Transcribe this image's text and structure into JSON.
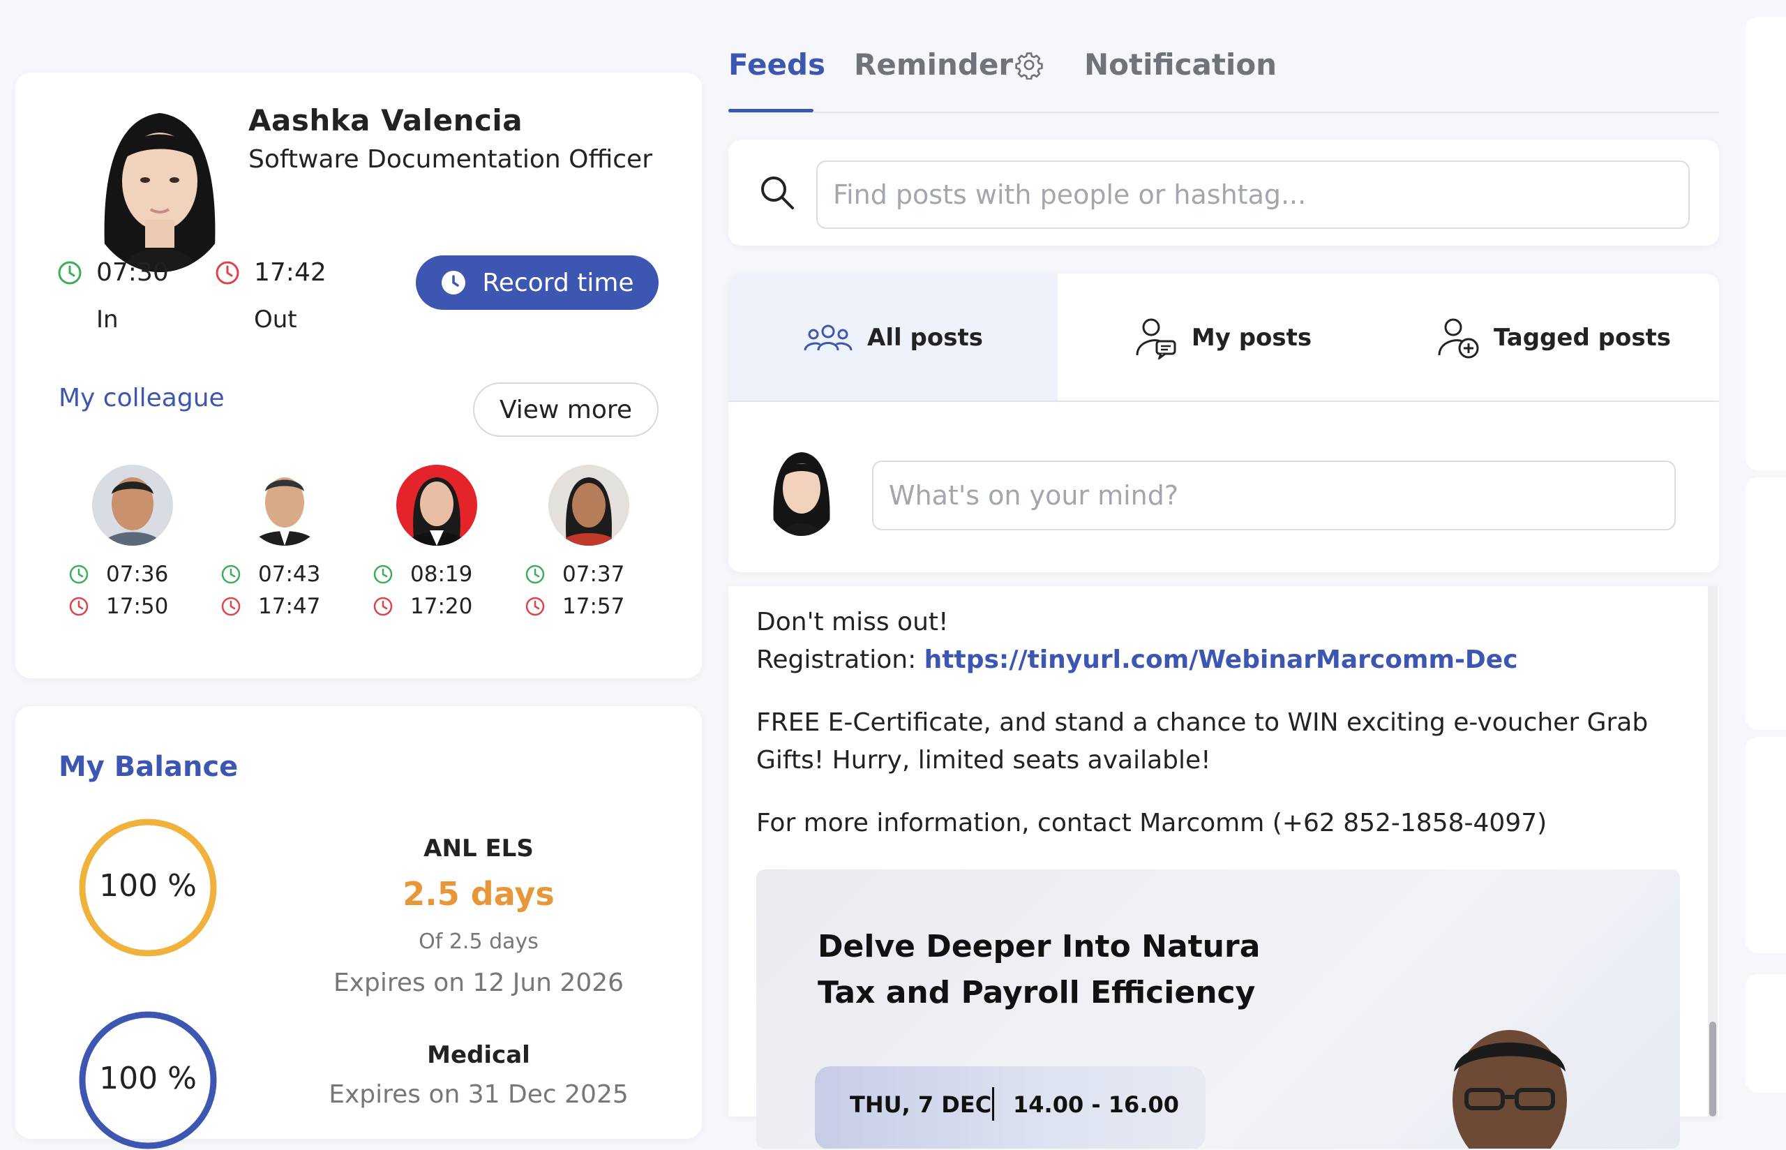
{
  "profile": {
    "name": "Aashka Valencia",
    "job_title": "Software Documentation Officer",
    "time_in": "07:30",
    "time_in_label": "In",
    "time_out": "17:42",
    "time_out_label": "Out",
    "record_button": "Record time"
  },
  "colleagues": {
    "title": "My colleague",
    "view_more": "View more",
    "items": [
      {
        "in": "07:36",
        "out": "17:50"
      },
      {
        "in": "07:43",
        "out": "17:47"
      },
      {
        "in": "08:19",
        "out": "17:20"
      },
      {
        "in": "07:37",
        "out": "17:57"
      }
    ]
  },
  "balance": {
    "title": "My Balance",
    "items": [
      {
        "percent": "100 %",
        "name": "ANL ELS",
        "days": "2.5 days",
        "of": "Of 2.5 days",
        "expires": "Expires on 12 Jun 2026",
        "ring_color": "#f0b23c"
      },
      {
        "percent": "100 %",
        "name": "Medical",
        "expires": "Expires on 31 Dec 2025",
        "ring_color": "#3d56b2"
      }
    ]
  },
  "tabs": {
    "feeds": "Feeds",
    "reminder": "Reminder",
    "notification": "Notification"
  },
  "search": {
    "placeholder": "Find posts with people or hashtag..."
  },
  "filters": {
    "all": "All posts",
    "mine": "My posts",
    "tagged": "Tagged posts"
  },
  "composer": {
    "placeholder": "What's on your mind?"
  },
  "post": {
    "line1": "Don't miss out!",
    "reg_label": "Registration: ",
    "reg_link": "https://tinyurl.com/WebinarMarcomm-Dec",
    "para1a": "FREE E-Certificate, and stand a chance to WIN exciting e-voucher Grab",
    "para1b": "Gifts! Hurry, limited seats available!",
    "para2": "For more information, contact Marcomm (+62 852-1858-4097)",
    "banner_title1": "Delve Deeper Into Natura",
    "banner_title2": "Tax and Payroll Efficiency",
    "banner_date": "THU, 7 DEC",
    "banner_time": "14.00 - 16.00"
  },
  "colors": {
    "accent": "#3d56b2",
    "in_clock": "#3cae5a",
    "out_clock": "#e0424b",
    "days": "#e8963a"
  }
}
